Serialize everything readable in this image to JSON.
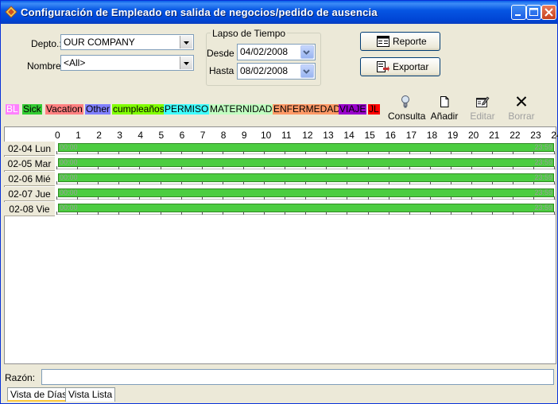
{
  "window": {
    "title": "Configuración de Empleado en salida de negocios/pedido de ausencia"
  },
  "filters": {
    "depto_label": "Depto.:",
    "depto_value": "OUR COMPANY",
    "nombre_label": "Nombre:",
    "nombre_value": "<All>",
    "period_group_label": "Lapso de Tiempo",
    "desde_label": "Desde",
    "desde_value": "04/02/2008",
    "hasta_label": "Hasta",
    "hasta_value": "08/02/2008"
  },
  "actions": {
    "reporte_label": "Reporte",
    "exportar_label": "Exportar"
  },
  "categories": [
    {
      "label": "BL",
      "bg": "#ff80ff",
      "fg": "#ffffff"
    },
    {
      "label": "Sick",
      "bg": "#33cc33",
      "fg": "#000000"
    },
    {
      "label": "Vacation",
      "bg": "#ff8080",
      "fg": "#000000"
    },
    {
      "label": "Other",
      "bg": "#8080ff",
      "fg": "#000000"
    },
    {
      "label": "cumpleaños",
      "bg": "#80ff00",
      "fg": "#000000"
    },
    {
      "label": "PERMISO",
      "bg": "#40ffff",
      "fg": "#000000"
    },
    {
      "label": "MATERNIDAD",
      "bg": "#c0ffc0",
      "fg": "#000000"
    },
    {
      "label": "ENFERMEDAD",
      "bg": "#ff9966",
      "fg": "#000000"
    },
    {
      "label": "VIAJE",
      "bg": "#9900cc",
      "fg": "#000000"
    },
    {
      "label": "JL",
      "bg": "#ff0000",
      "fg": "#000000"
    }
  ],
  "toolbar": {
    "consulta_label": "Consulta",
    "anadir_label": "Añadir",
    "editar_label": "Editar",
    "borrar_label": "Borrar"
  },
  "schedule": {
    "hours": [
      "0",
      "1",
      "2",
      "3",
      "4",
      "5",
      "6",
      "7",
      "8",
      "9",
      "10",
      "11",
      "12",
      "13",
      "14",
      "15",
      "16",
      "17",
      "18",
      "19",
      "20",
      "21",
      "22",
      "23",
      "24"
    ],
    "rows": [
      {
        "day": "02-04 Lun",
        "start": "00:00",
        "end": "23:59"
      },
      {
        "day": "02-05 Mar",
        "start": "00:00",
        "end": "23:59"
      },
      {
        "day": "02-06 Mié",
        "start": "00:00",
        "end": "23:59"
      },
      {
        "day": "02-07 Jue",
        "start": "00:00",
        "end": "23:59"
      },
      {
        "day": "02-08 Vie",
        "start": "00:00",
        "end": "23:59"
      }
    ],
    "bar_color": "#4ccd41"
  },
  "footer": {
    "razon_label": "Razón:",
    "razon_value": "",
    "tabs": [
      {
        "label": "Vista de Días",
        "active": true
      },
      {
        "label": "Vista Lista",
        "active": false
      }
    ]
  }
}
